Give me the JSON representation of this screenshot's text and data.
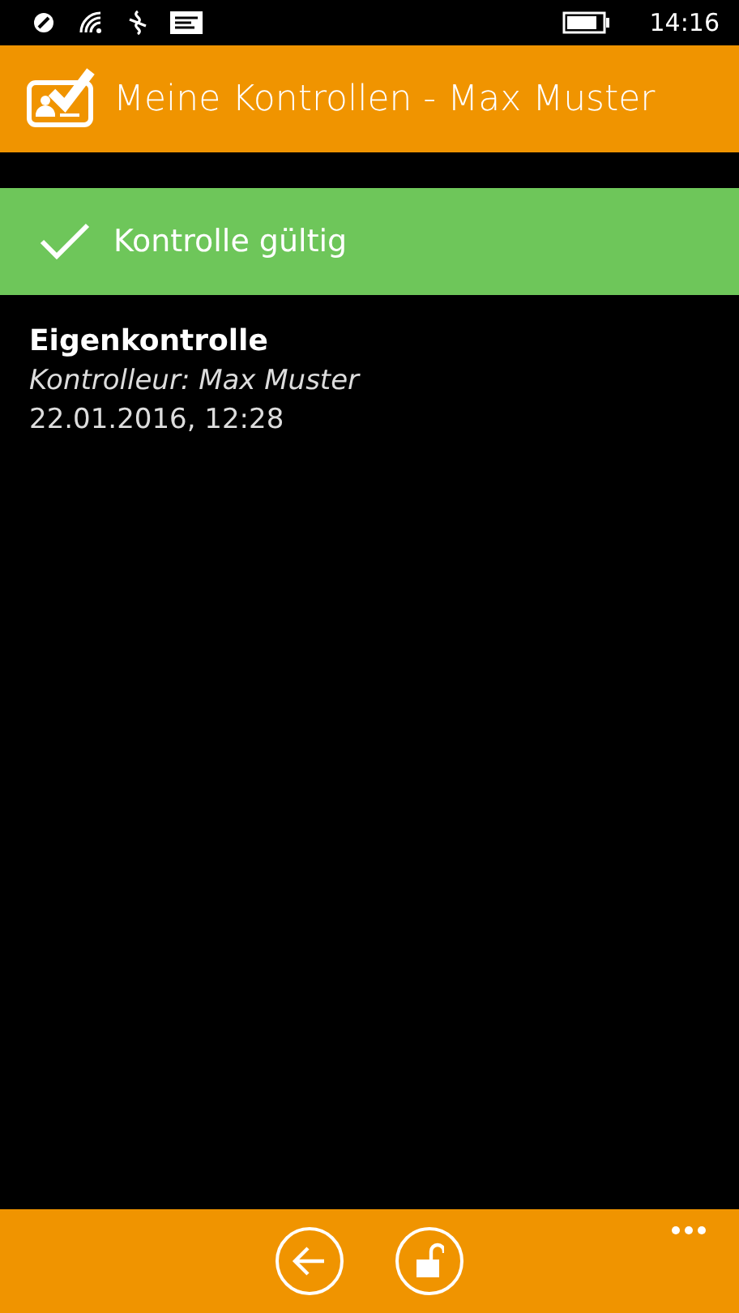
{
  "status_bar": {
    "time": "14:16"
  },
  "header": {
    "title": "Meine Kontrollen - Max Muster"
  },
  "result": {
    "label": "Kontrolle gültig",
    "valid": true
  },
  "entry": {
    "title": "Eigenkontrolle",
    "inspector": "Kontrolleur: Max Muster",
    "timestamp": "22.01.2016, 12:28"
  },
  "app_bar": {
    "buttons": [
      {
        "kind": "back"
      },
      {
        "kind": "unlock"
      }
    ]
  }
}
